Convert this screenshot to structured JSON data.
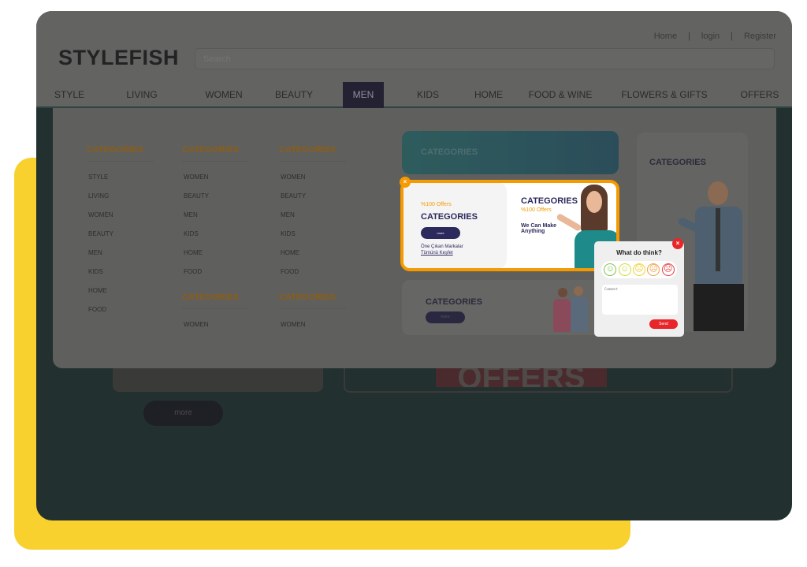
{
  "brand": "STYLEFISH",
  "search": {
    "placeholder": "Search"
  },
  "toplinks": {
    "home": "Home",
    "sep": "|",
    "login": "login",
    "register": "Register"
  },
  "nav": [
    "STYLE",
    "LIVING",
    "WOMEN",
    "BEAUTY",
    "MEN",
    "KIDS",
    "HOME",
    "FOOD & WINE",
    "FLOWERS & GIFTS",
    "OFFERS"
  ],
  "nav_active": "MEN",
  "mega": {
    "col1": {
      "title": "CATEGORIES",
      "items": [
        "STYLE",
        "LIVING",
        "WOMEN",
        "BEAUTY",
        "MEN",
        "KIDS",
        "HOME",
        "FOOD"
      ]
    },
    "col2": {
      "title": "CATEGORIES",
      "items": [
        "WOMEN",
        "BEAUTY",
        "MEN",
        "KIDS",
        "HOME",
        "FOOD"
      ],
      "title2": "CATEGORIES",
      "items2": [
        "WOMEN"
      ]
    },
    "col3": {
      "title": "CATEGORIES",
      "items": [
        "WOMEN",
        "BEAUTY",
        "MEN",
        "KIDS",
        "HOME",
        "FOOD"
      ],
      "title2": "CATEGORIES",
      "items2": [
        "WOMEN"
      ]
    }
  },
  "cards": {
    "teal": {
      "title": "CATEGORIES"
    },
    "promo": {
      "offer": "%100 Offers",
      "title": "CATEGORIES",
      "button": "more",
      "link1": "Öne Çıkan Markalar",
      "link2": "Tümünü Keşfet",
      "right_title": "CATEGORIES",
      "right_offer": "%100 Offers",
      "tagline1": "We Can Make",
      "tagline2": "Anything",
      "close": "×"
    },
    "kids": {
      "title": "CATEGORIES",
      "button": "more"
    },
    "man": {
      "title": "CATEGORIES"
    }
  },
  "feedback": {
    "title": "What do think?",
    "faces": [
      "very-happy",
      "happy",
      "neutral-sad",
      "sad",
      "very-sad"
    ],
    "comment_placeholder": "Comment",
    "send": "Send",
    "close": "×"
  },
  "background": {
    "offers": "OFFERS",
    "more": "more"
  },
  "colors": {
    "accent": "#f59a00",
    "brand_dark": "#2c2a5c",
    "send": "#e8262a",
    "yellow": "#f8d12f"
  }
}
